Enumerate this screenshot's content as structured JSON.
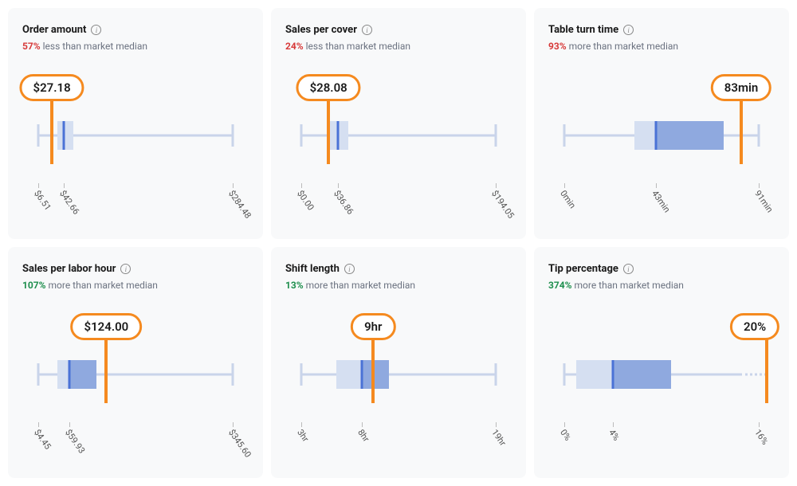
{
  "chart_data": [
    {
      "id": "order-amount",
      "title": "Order amount",
      "pct_text": "57%",
      "direction": "less",
      "tail_text": "less than market median",
      "your_value_label": "$27.18",
      "axis": [
        {
          "pos_pct": 0,
          "label": "$6.51"
        },
        {
          "pos_pct": 13,
          "label": "$42.66"
        },
        {
          "pos_pct": 100,
          "label": "$284.48"
        }
      ],
      "whisker_min_pct": 0,
      "whisker_max_pct": 100,
      "box_lo_pct": 10,
      "box_hi_pct": 18,
      "q1_pct": 10,
      "q3_pct": 18,
      "median_pct": 13,
      "your_pct": 7,
      "mid_box": false,
      "dashed_right": false
    },
    {
      "id": "sales-per-cover",
      "title": "Sales per cover",
      "pct_text": "24%",
      "direction": "less",
      "tail_text": "less than market median",
      "your_value_label": "$28.08",
      "axis": [
        {
          "pos_pct": 0,
          "label": "$0.00"
        },
        {
          "pos_pct": 19,
          "label": "$36.86"
        },
        {
          "pos_pct": 100,
          "label": "$194.05"
        }
      ],
      "whisker_min_pct": 0,
      "whisker_max_pct": 100,
      "box_lo_pct": 13,
      "box_hi_pct": 24,
      "q1_pct": 13,
      "q3_pct": 24,
      "median_pct": 19,
      "your_pct": 14,
      "mid_box": false,
      "dashed_right": false
    },
    {
      "id": "table-turn-time",
      "title": "Table turn time",
      "pct_text": "93%",
      "direction": "less",
      "tail_text": "more than market median",
      "your_value_label": "83min",
      "axis": [
        {
          "pos_pct": 0,
          "label": "0min"
        },
        {
          "pos_pct": 47,
          "label": "43min"
        },
        {
          "pos_pct": 100,
          "label": "91min"
        }
      ],
      "whisker_min_pct": 0,
      "whisker_max_pct": 100,
      "box_lo_pct": 36,
      "box_hi_pct": 82,
      "q1_pct": 36,
      "q3_pct": 82,
      "median_pct": 47,
      "your_pct": 91,
      "mid_box": true,
      "dashed_right": false
    },
    {
      "id": "sales-per-labor-hour",
      "title": "Sales per labor hour",
      "pct_text": "107%",
      "direction": "more",
      "tail_text": "more than market median",
      "your_value_label": "$124.00",
      "axis": [
        {
          "pos_pct": 0,
          "label": "$4.45"
        },
        {
          "pos_pct": 16,
          "label": "$59.93"
        },
        {
          "pos_pct": 100,
          "label": "$345.60"
        }
      ],
      "whisker_min_pct": 0,
      "whisker_max_pct": 100,
      "box_lo_pct": 10,
      "box_hi_pct": 30,
      "q1_pct": 10,
      "q3_pct": 30,
      "median_pct": 16,
      "your_pct": 35,
      "mid_box": true,
      "dashed_right": false
    },
    {
      "id": "shift-length",
      "title": "Shift length",
      "pct_text": "13%",
      "direction": "more",
      "tail_text": "more than market median",
      "your_value_label": "9hr",
      "axis": [
        {
          "pos_pct": 0,
          "label": "3hr"
        },
        {
          "pos_pct": 31,
          "label": "8hr"
        },
        {
          "pos_pct": 100,
          "label": "19hr"
        }
      ],
      "whisker_min_pct": 0,
      "whisker_max_pct": 100,
      "box_lo_pct": 18,
      "box_hi_pct": 45,
      "q1_pct": 18,
      "q3_pct": 45,
      "median_pct": 31,
      "your_pct": 37,
      "mid_box": true,
      "dashed_right": false
    },
    {
      "id": "tip-percentage",
      "title": "Tip percentage",
      "pct_text": "374%",
      "direction": "more",
      "tail_text": "more than market median",
      "your_value_label": "20%",
      "axis": [
        {
          "pos_pct": 0,
          "label": "0%"
        },
        {
          "pos_pct": 25,
          "label": "4%"
        },
        {
          "pos_pct": 100,
          "label": "16%"
        }
      ],
      "whisker_min_pct": 0,
      "whisker_max_pct": 100,
      "box_lo_pct": 6,
      "box_hi_pct": 55,
      "q1_pct": 6,
      "q3_pct": 55,
      "median_pct": 25,
      "your_pct": 110,
      "mid_box": true,
      "dashed_right": true
    }
  ]
}
